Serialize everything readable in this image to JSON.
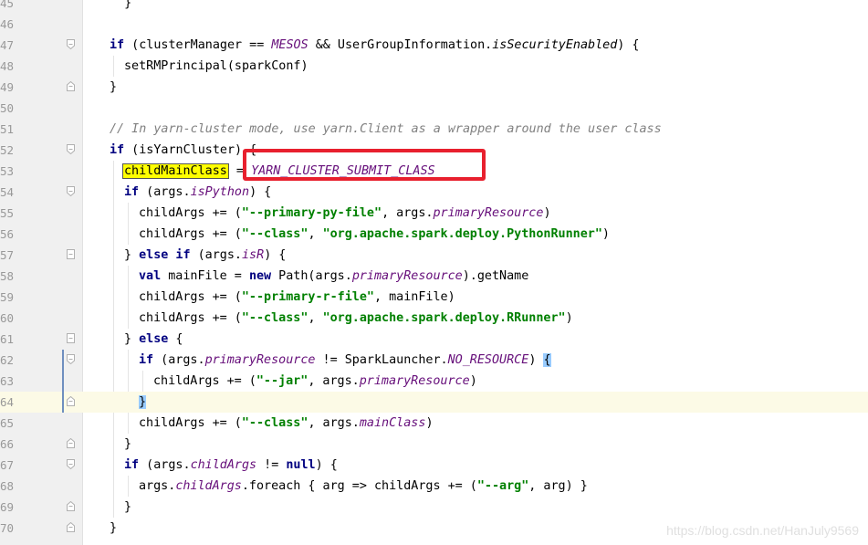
{
  "editor": {
    "lines": [
      {
        "num": "45",
        "tokens": [
          [
            "ident",
            "  }"
          ]
        ],
        "indent": 0
      },
      {
        "num": "46",
        "tokens": [],
        "indent": 0
      },
      {
        "num": "47",
        "tokens": [
          [
            "kw",
            "if"
          ],
          [
            "ident",
            " (clusterManager == "
          ],
          [
            "const",
            "MESOS"
          ],
          [
            "ident",
            " && UserGroupInformation."
          ],
          [
            "mth",
            "isSecurityEnabled"
          ],
          [
            "ident",
            ") {"
          ]
        ],
        "indent": 0
      },
      {
        "num": "48",
        "tokens": [
          [
            "ident",
            "setRMPrincipal(sparkConf)"
          ]
        ],
        "indent": 1
      },
      {
        "num": "49",
        "tokens": [
          [
            "ident",
            "}"
          ]
        ],
        "indent": 0
      },
      {
        "num": "50",
        "tokens": [],
        "indent": 0
      },
      {
        "num": "51",
        "tokens": [
          [
            "cmt",
            "// In yarn-cluster mode, use yarn.Client as a wrapper around the user class"
          ]
        ],
        "indent": 0
      },
      {
        "num": "52",
        "tokens": [
          [
            "kw",
            "if"
          ],
          [
            "ident",
            " (isYarnCluster) {"
          ]
        ],
        "indent": 0
      },
      {
        "num": "53",
        "tokens": [
          [
            "hl-ident",
            "childMainClass"
          ],
          [
            "ident",
            " = "
          ],
          [
            "const",
            "YARN_CLUSTER_SUBMIT_CLASS"
          ]
        ],
        "indent": 1
      },
      {
        "num": "54",
        "tokens": [
          [
            "kw",
            "if"
          ],
          [
            "ident",
            " (args."
          ],
          [
            "fld",
            "isPython"
          ],
          [
            "ident",
            ") {"
          ]
        ],
        "indent": 1
      },
      {
        "num": "55",
        "tokens": [
          [
            "ident",
            "childArgs += ("
          ],
          [
            "str",
            "\"--primary-py-file\""
          ],
          [
            "ident",
            ", args."
          ],
          [
            "fld",
            "primaryResource"
          ],
          [
            "ident",
            ")"
          ]
        ],
        "indent": 2
      },
      {
        "num": "56",
        "tokens": [
          [
            "ident",
            "childArgs += ("
          ],
          [
            "str",
            "\"--class\""
          ],
          [
            "ident",
            ", "
          ],
          [
            "str",
            "\"org.apache.spark.deploy.PythonRunner\""
          ],
          [
            "ident",
            ")"
          ]
        ],
        "indent": 2
      },
      {
        "num": "57",
        "tokens": [
          [
            "ident",
            "} "
          ],
          [
            "kw",
            "else if"
          ],
          [
            "ident",
            " (args."
          ],
          [
            "fld",
            "isR"
          ],
          [
            "ident",
            ") {"
          ]
        ],
        "indent": 1
      },
      {
        "num": "58",
        "tokens": [
          [
            "kw",
            "val"
          ],
          [
            "ident",
            " mainFile = "
          ],
          [
            "kw",
            "new"
          ],
          [
            "ident",
            " Path(args."
          ],
          [
            "fld",
            "primaryResource"
          ],
          [
            "ident",
            ").getName"
          ]
        ],
        "indent": 2
      },
      {
        "num": "59",
        "tokens": [
          [
            "ident",
            "childArgs += ("
          ],
          [
            "str",
            "\"--primary-r-file\""
          ],
          [
            "ident",
            ", mainFile)"
          ]
        ],
        "indent": 2
      },
      {
        "num": "60",
        "tokens": [
          [
            "ident",
            "childArgs += ("
          ],
          [
            "str",
            "\"--class\""
          ],
          [
            "ident",
            ", "
          ],
          [
            "str",
            "\"org.apache.spark.deploy.RRunner\""
          ],
          [
            "ident",
            ")"
          ]
        ],
        "indent": 2
      },
      {
        "num": "61",
        "tokens": [
          [
            "ident",
            "} "
          ],
          [
            "kw",
            "else"
          ],
          [
            "ident",
            " {"
          ]
        ],
        "indent": 1
      },
      {
        "num": "62",
        "tokens": [
          [
            "kw",
            "if"
          ],
          [
            "ident",
            " (args."
          ],
          [
            "fld",
            "primaryResource"
          ],
          [
            "ident",
            " != SparkLauncher."
          ],
          [
            "const",
            "NO_RESOURCE"
          ],
          [
            "ident",
            ") "
          ],
          [
            "brace-match",
            "{"
          ]
        ],
        "indent": 2
      },
      {
        "num": "63",
        "tokens": [
          [
            "ident",
            "childArgs += ("
          ],
          [
            "str",
            "\"--jar\""
          ],
          [
            "ident",
            ", args."
          ],
          [
            "fld",
            "primaryResource"
          ],
          [
            "ident",
            ")"
          ]
        ],
        "indent": 3
      },
      {
        "num": "64",
        "tokens": [
          [
            "brace-match",
            "}"
          ]
        ],
        "indent": 2
      },
      {
        "num": "65",
        "tokens": [
          [
            "ident",
            "childArgs += ("
          ],
          [
            "str",
            "\"--class\""
          ],
          [
            "ident",
            ", args."
          ],
          [
            "fld",
            "mainClass"
          ],
          [
            "ident",
            ")"
          ]
        ],
        "indent": 2
      },
      {
        "num": "66",
        "tokens": [
          [
            "ident",
            "}"
          ]
        ],
        "indent": 1
      },
      {
        "num": "67",
        "tokens": [
          [
            "kw",
            "if"
          ],
          [
            "ident",
            " (args."
          ],
          [
            "fld",
            "childArgs"
          ],
          [
            "ident",
            " != "
          ],
          [
            "kw",
            "null"
          ],
          [
            "ident",
            ") {"
          ]
        ],
        "indent": 1
      },
      {
        "num": "68",
        "tokens": [
          [
            "ident",
            "args."
          ],
          [
            "fld",
            "childArgs"
          ],
          [
            "ident",
            ".foreach { arg => childArgs += ("
          ],
          [
            "str",
            "\"--arg\""
          ],
          [
            "ident",
            ", arg) }"
          ]
        ],
        "indent": 2
      },
      {
        "num": "69",
        "tokens": [
          [
            "ident",
            "}"
          ]
        ],
        "indent": 1
      },
      {
        "num": "70",
        "tokens": [
          [
            "ident",
            "}"
          ]
        ],
        "indent": 0
      }
    ]
  },
  "watermark": "https://blog.csdn.net/HanJuly9569",
  "colors": {
    "keyword": "#000080",
    "string": "#008000",
    "field": "#660e7a",
    "comment": "#808080",
    "highlight": "#ffff00",
    "annotation_box": "#e8202e",
    "current_line": "#fcfae6"
  }
}
